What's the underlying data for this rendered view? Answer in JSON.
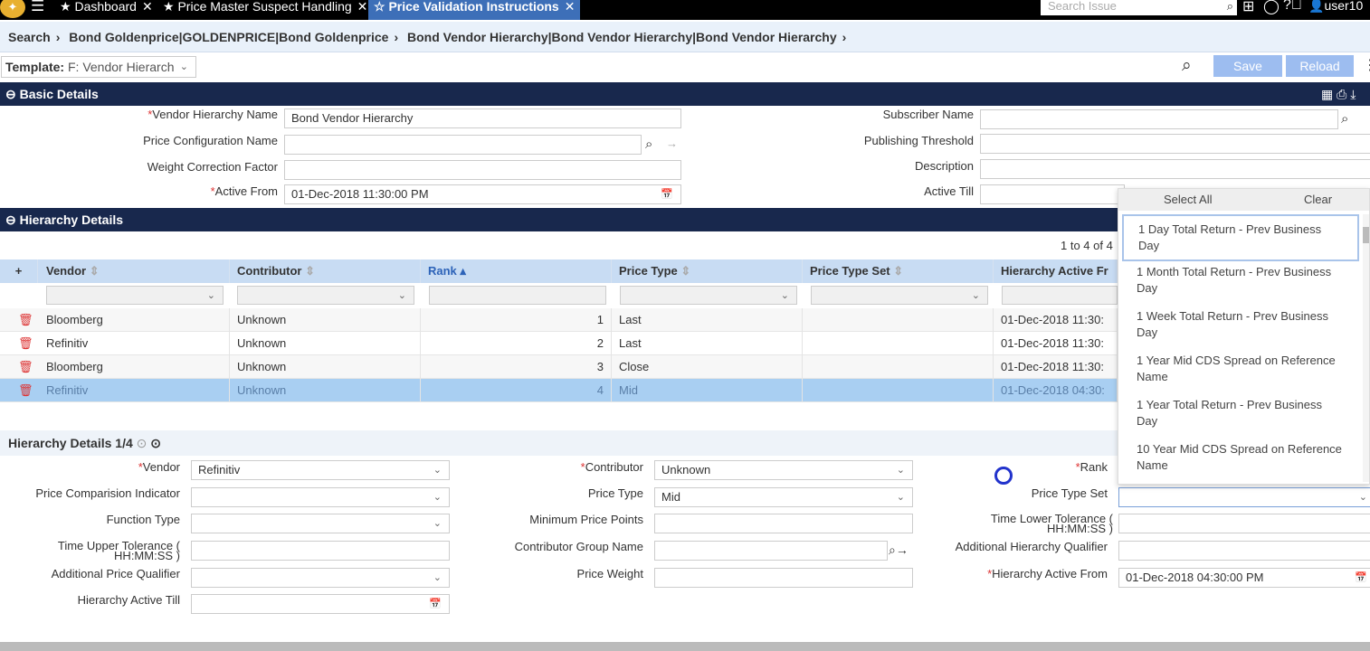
{
  "topbar": {
    "tabs": [
      {
        "label": "Dashboard"
      },
      {
        "label": "Price Master Suspect Handling"
      },
      {
        "label": "Price Validation Instructions"
      }
    ],
    "search_placeholder": "Search Issue",
    "user": "user10"
  },
  "breadcrumb": [
    "Search",
    "Bond Goldenprice|GOLDENPRICE|Bond Goldenprice",
    "Bond Vendor Hierarchy|Bond Vendor Hierarchy|Bond Vendor Hierarchy"
  ],
  "toolbar": {
    "template_label": "Template:",
    "template_value": "F: Vendor Hierarch",
    "save": "Save",
    "reload": "Reload"
  },
  "basic": {
    "title": "Basic Details",
    "vendor_hierarchy_name_label": "Vendor Hierarchy Name",
    "vendor_hierarchy_name": "Bond Vendor Hierarchy",
    "price_config_label": "Price Configuration Name",
    "weight_label": "Weight Correction Factor",
    "active_from_label": "Active From",
    "active_from": "01-Dec-2018 11:30:00 PM",
    "subscriber_label": "Subscriber Name",
    "publishing_label": "Publishing Threshold",
    "description_label": "Description",
    "active_till_label": "Active Till"
  },
  "hierarchy": {
    "title": "Hierarchy Details",
    "paging": "1 to 4 of 4",
    "columns": [
      "Vendor",
      "Contributor",
      "Rank",
      "Price Type",
      "Price Type Set",
      "Hierarchy Active Fr"
    ],
    "rows": [
      [
        "Bloomberg",
        "Unknown",
        "1",
        "Last",
        "",
        "01-Dec-2018 11:30:"
      ],
      [
        "Refinitiv",
        "Unknown",
        "2",
        "Last",
        "",
        "01-Dec-2018 11:30:"
      ],
      [
        "Bloomberg",
        "Unknown",
        "3",
        "Close",
        "",
        "01-Dec-2018 11:30:"
      ],
      [
        "Refinitiv",
        "Unknown",
        "4",
        "Mid",
        "",
        "01-Dec-2018 04:30:"
      ]
    ]
  },
  "detail": {
    "title": "Hierarchy Details 1/4",
    "vendor_label": "Vendor",
    "vendor": "Refinitiv",
    "pci_label": "Price Comparision Indicator",
    "function_label": "Function Type",
    "tut_label1": "Time Upper Tolerance (",
    "tut_label2": "HH:MM:SS )",
    "apq_label": "Additional Price Qualifier",
    "hat_label": "Hierarchy Active Till",
    "contributor_label": "Contributor",
    "contributor": "Unknown",
    "price_type_label": "Price Type",
    "price_type": "Mid",
    "mpp_label": "Minimum Price Points",
    "cgn_label": "Contributor Group Name",
    "pw_label": "Price Weight",
    "rank_label": "Rank",
    "pts_label": "Price Type Set",
    "tlt_label1": "Time Lower Tolerance (",
    "tlt_label2": "HH:MM:SS )",
    "ahq_label": "Additional Hierarchy Qualifier",
    "haf_label": "Hierarchy Active From",
    "haf": "01-Dec-2018 04:30:00 PM"
  },
  "dropdown": {
    "select_all": "Select All",
    "clear": "Clear",
    "options": [
      "1 Day Total Return - Prev Business Day",
      "1 Month Total Return - Prev Business Day",
      "1 Week Total Return - Prev Business Day",
      "1 Year Mid CDS Spread on Reference Name",
      "1 Year Total Return - Prev Business Day",
      "10 Year Mid CDS Spread on Reference Name"
    ]
  }
}
